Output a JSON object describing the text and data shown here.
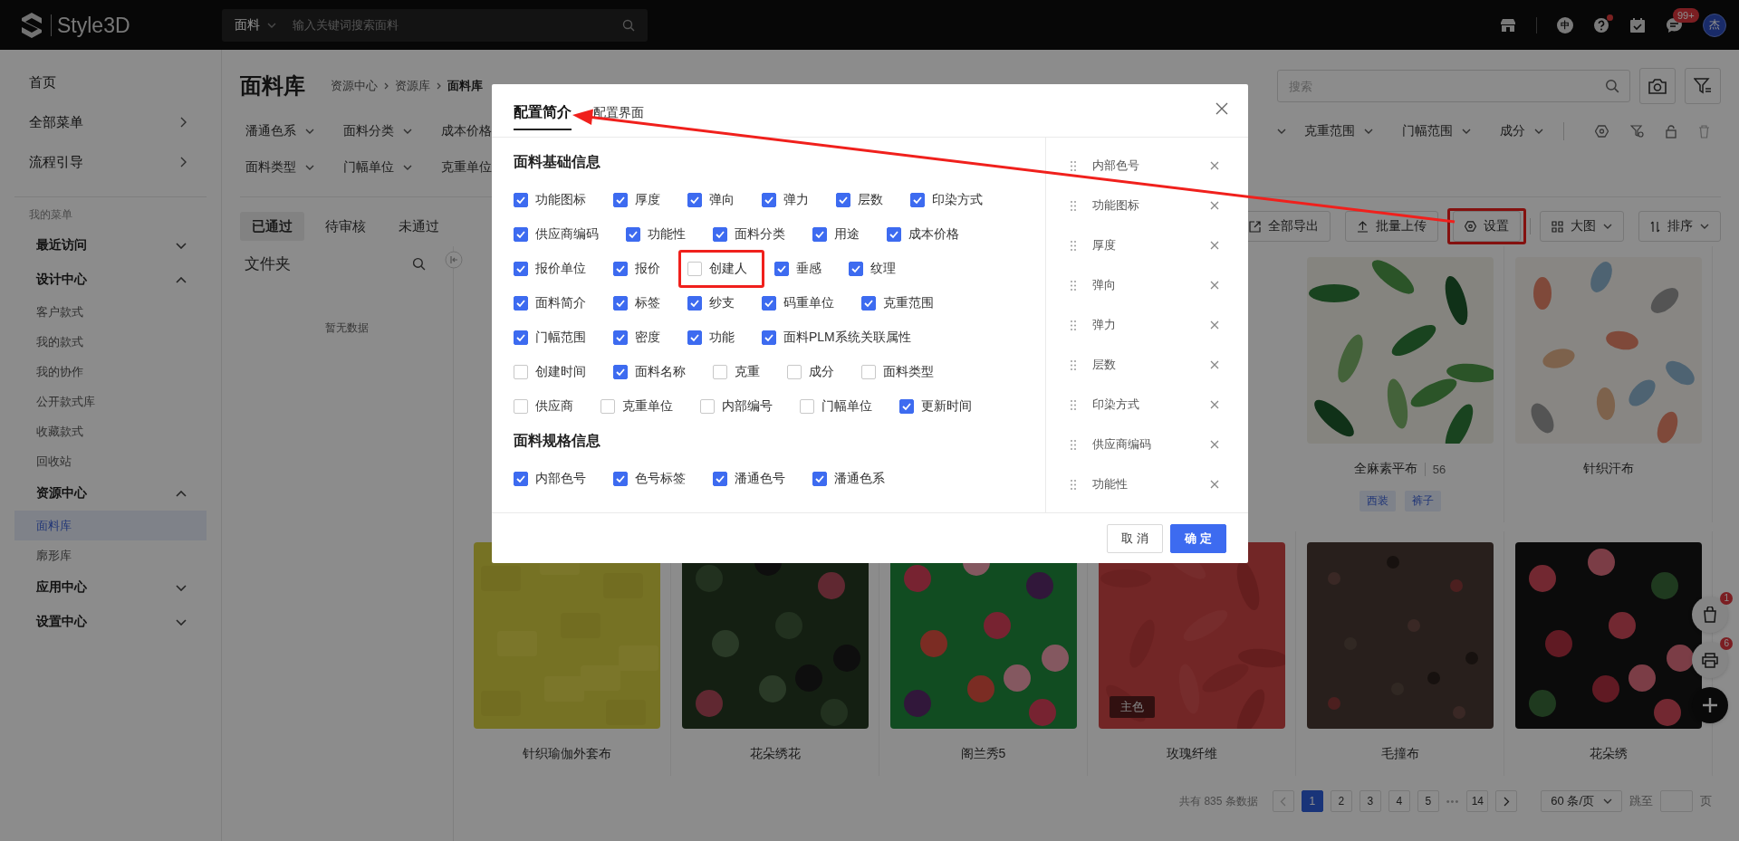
{
  "topbar": {
    "logo": "Style3D",
    "search": {
      "scope": "面料",
      "placeholder": "输入关键词搜索面料"
    },
    "language": "中",
    "help_dot": true,
    "message_badge": "99+",
    "avatar": "杰"
  },
  "sidebar": {
    "items": [
      {
        "label": "首页",
        "has_arrow": false
      },
      {
        "label": "全部菜单",
        "has_arrow": true
      },
      {
        "label": "流程引导",
        "has_arrow": true
      }
    ],
    "section_label": "我的菜单",
    "groups": [
      {
        "label": "最近访问",
        "expanded": false
      },
      {
        "label": "设计中心",
        "expanded": true,
        "children": [
          {
            "label": "客户款式",
            "selected": false
          },
          {
            "label": "我的款式",
            "selected": false
          },
          {
            "label": "我的协作",
            "selected": false
          },
          {
            "label": "公开款式库",
            "selected": false
          },
          {
            "label": "收藏款式",
            "selected": false
          },
          {
            "label": "回收站",
            "selected": false
          }
        ]
      },
      {
        "label": "资源中心",
        "expanded": true,
        "children": [
          {
            "label": "面料库",
            "selected": true
          },
          {
            "label": "廓形库",
            "selected": false
          }
        ]
      },
      {
        "label": "应用中心",
        "expanded": false
      },
      {
        "label": "设置中心",
        "expanded": false
      }
    ]
  },
  "page": {
    "title": "面料库",
    "breadcrumb": [
      "资源中心",
      "资源库",
      "面料库"
    ],
    "search": {
      "placeholder": "搜索"
    }
  },
  "filters": {
    "row_1_left": [
      "潘通色系",
      "面料分类",
      "成本价格"
    ],
    "row_1_right": [
      "克重范围",
      "门幅范围",
      "成分"
    ],
    "row_2": [
      "面料类型",
      "门幅单位",
      "克重单位"
    ]
  },
  "status_tabs": [
    {
      "label": "已通过",
      "selected": true
    },
    {
      "label": "待审核",
      "selected": false
    },
    {
      "label": "未通过",
      "selected": false
    }
  ],
  "actions": [
    {
      "kind": "export",
      "label": "全部导出",
      "highlighted": false
    },
    {
      "kind": "upload",
      "label": "批量上传",
      "highlighted": false
    },
    {
      "kind": "settings",
      "label": "设置",
      "highlighted": true
    },
    {
      "kind": "view",
      "label": "大图",
      "highlighted": false
    },
    {
      "kind": "sort",
      "label": "排序",
      "highlighted": false
    }
  ],
  "folder_pane": {
    "title": "文件夹",
    "empty_text": "暂无数据"
  },
  "grid": {
    "rows": [
      [
        "",
        "",
        "",
        "",
        {
          "kind": "card",
          "title": "全麻素平布",
          "count": "56",
          "tags": [
            "西装",
            "裤子"
          ]
        },
        {
          "kind": "card",
          "title": "针织汗布"
        }
      ],
      [
        {
          "kind": "card",
          "title": "针织瑜伽外套布"
        },
        {
          "kind": "card",
          "title": "花朵绣花"
        },
        {
          "kind": "card",
          "title": "阁兰秀5"
        },
        {
          "kind": "card",
          "title": "玫瑰纤维",
          "badge": "主色"
        },
        {
          "kind": "card",
          "title": "毛撞布"
        },
        {
          "kind": "card",
          "title": "花朵绣"
        }
      ]
    ]
  },
  "pagination": {
    "total": "共有 835 条数据",
    "pages": [
      {
        "kind": "page",
        "label": "1",
        "selected": true
      },
      {
        "kind": "page",
        "label": "2",
        "selected": false
      },
      {
        "kind": "page",
        "label": "3",
        "selected": false
      },
      {
        "kind": "page",
        "label": "4",
        "selected": false
      },
      {
        "kind": "page",
        "label": "5",
        "selected": false
      },
      {
        "kind": "ellipsis",
        "label": "•••",
        "selected": false
      },
      {
        "kind": "page",
        "label": "14",
        "selected": false
      }
    ],
    "page_size": "60 条/页",
    "jump_label": "跳至",
    "jump_suffix": "页"
  },
  "float_buttons": [
    {
      "kind": "bag",
      "badge": "1"
    },
    {
      "kind": "print",
      "badge": "6"
    },
    {
      "kind": "add"
    }
  ],
  "modal": {
    "tabs": [
      {
        "label": "配置简介",
        "selected": true
      },
      {
        "label": "配置界面",
        "selected": false
      }
    ],
    "sections": [
      {
        "title": "面料基础信息",
        "rows": [
          [
            {
              "label": "功能图标",
              "checked": true,
              "highlighted": false
            },
            {
              "label": "厚度",
              "checked": true,
              "highlighted": false
            },
            {
              "label": "弹向",
              "checked": true,
              "highlighted": false
            },
            {
              "label": "弹力",
              "checked": true,
              "highlighted": false
            },
            {
              "label": "层数",
              "checked": true,
              "highlighted": false
            },
            {
              "label": "印染方式",
              "checked": true,
              "highlighted": false
            }
          ],
          [
            {
              "label": "供应商编码",
              "checked": true,
              "highlighted": false
            },
            {
              "label": "功能性",
              "checked": true,
              "highlighted": false
            },
            {
              "label": "面料分类",
              "checked": true,
              "highlighted": false
            },
            {
              "label": "用途",
              "checked": true,
              "highlighted": false
            },
            {
              "label": "成本价格",
              "checked": true,
              "highlighted": false
            }
          ],
          [
            {
              "label": "报价单位",
              "checked": true,
              "highlighted": false
            },
            {
              "label": "报价",
              "checked": true,
              "highlighted": false
            },
            {
              "label": "创建人",
              "checked": false,
              "highlighted": true
            },
            {
              "label": "垂感",
              "checked": true,
              "highlighted": false
            },
            {
              "label": "纹理",
              "checked": true,
              "highlighted": false
            }
          ],
          [
            {
              "label": "面料简介",
              "checked": true,
              "highlighted": false
            },
            {
              "label": "标签",
              "checked": true,
              "highlighted": false
            },
            {
              "label": "纱支",
              "checked": true,
              "highlighted": false
            },
            {
              "label": "码重单位",
              "checked": true,
              "highlighted": false
            },
            {
              "label": "克重范围",
              "checked": true,
              "highlighted": false
            }
          ],
          [
            {
              "label": "门幅范围",
              "checked": true,
              "highlighted": false
            },
            {
              "label": "密度",
              "checked": true,
              "highlighted": false
            },
            {
              "label": "功能",
              "checked": true,
              "highlighted": false
            },
            {
              "label": "面料PLM系统关联属性",
              "checked": true,
              "highlighted": false
            }
          ],
          [
            {
              "label": "创建时间",
              "checked": false,
              "highlighted": false
            },
            {
              "label": "面料名称",
              "checked": true,
              "highlighted": false
            },
            {
              "label": "克重",
              "checked": false,
              "highlighted": false
            },
            {
              "label": "成分",
              "checked": false,
              "highlighted": false
            },
            {
              "label": "面料类型",
              "checked": false,
              "highlighted": false
            }
          ],
          [
            {
              "label": "供应商",
              "checked": false,
              "highlighted": false
            },
            {
              "label": "克重单位",
              "checked": false,
              "highlighted": false
            },
            {
              "label": "内部编号",
              "checked": false,
              "highlighted": false
            },
            {
              "label": "门幅单位",
              "checked": false,
              "highlighted": false
            },
            {
              "label": "更新时间",
              "checked": true,
              "highlighted": false
            }
          ]
        ]
      },
      {
        "title": "面料规格信息",
        "rows": [
          [
            {
              "label": "内部色号",
              "checked": true,
              "highlighted": false
            },
            {
              "label": "色号标签",
              "checked": true,
              "highlighted": false
            },
            {
              "label": "潘通色号",
              "checked": true,
              "highlighted": false
            },
            {
              "label": "潘通色系",
              "checked": true,
              "highlighted": false
            }
          ]
        ]
      }
    ],
    "selected_fields": [
      "内部色号",
      "功能图标",
      "厚度",
      "弹向",
      "弹力",
      "层数",
      "印染方式",
      "供应商编码",
      "功能性"
    ],
    "buttons": [
      {
        "kind": "cancel",
        "label": "取消"
      },
      {
        "kind": "confirm",
        "label": "确定"
      }
    ]
  }
}
